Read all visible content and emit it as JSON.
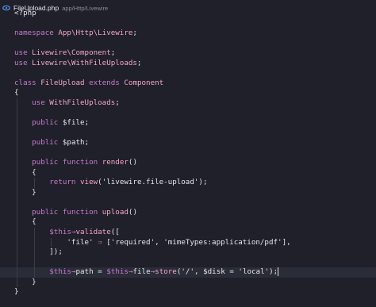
{
  "tab": {
    "filename": "FileUpload.php",
    "path": "app/Http/Livewire",
    "icon": "file-php-icon"
  },
  "colors": {
    "background": "#1f2029",
    "keyword": "#c67bd0",
    "identifier": "#f4a6c9",
    "text": "#e4e5ea",
    "line_highlight": "#2a2c38"
  },
  "code": {
    "l1": "<?php",
    "l3_kw": "namespace",
    "l3_ns": "App\\Http\\Livewire",
    "l3_end": ";",
    "l5_kw": "use",
    "l5_ns": "Livewire\\Component",
    "l5_end": ";",
    "l6_kw": "use",
    "l6_ns": "Livewire\\WithFileUploads",
    "l6_end": ";",
    "l8_kw1": "class",
    "l8_name": "FileUpload",
    "l8_kw2": "extends",
    "l8_parent": "Component",
    "l9": "{",
    "l10_kw": "use",
    "l10_ns": "WithFileUploads",
    "l10_end": ";",
    "l12_kw": "public",
    "l12_var": "$file",
    "l12_end": ";",
    "l14_kw": "public",
    "l14_var": "$path",
    "l14_end": ";",
    "l16_kw1": "public",
    "l16_kw2": "function",
    "l16_fn": "render",
    "l16_end": "()",
    "l17": "{",
    "l18_kw": "return",
    "l18_fn": "view",
    "l18_open": "(",
    "l18_str": "'livewire.file-upload'",
    "l18_end": ");",
    "l19": "}",
    "l21_kw1": "public",
    "l21_kw2": "function",
    "l21_fn": "upload",
    "l21_end": "()",
    "l22": "{",
    "l23_this": "$this",
    "l23_arrow": "→",
    "l23_fn": "validate",
    "l23_end": "([",
    "l24_str1": "'file'",
    "l24_arrow": "⇒",
    "l24_open": "[",
    "l24_str2": "'required'",
    "l24_comma": ",",
    "l24_str3": "'mimeTypes:application/pdf'",
    "l24_end": "],",
    "l25": "]);",
    "l27_this": "$this",
    "l27_arrow1": "→",
    "l27_prop": "path",
    "l27_eq": "=",
    "l27_this2": "$this",
    "l27_arrow2": "→",
    "l27_prop2": "file",
    "l27_arrow3": "→",
    "l27_fn": "store",
    "l27_open": "(",
    "l27_str1": "'/'",
    "l27_comma": ",",
    "l27_var": "$disk",
    "l27_eq2": "=",
    "l27_str2": "'local'",
    "l27_end": ");",
    "l28": "}",
    "l29": "}"
  }
}
